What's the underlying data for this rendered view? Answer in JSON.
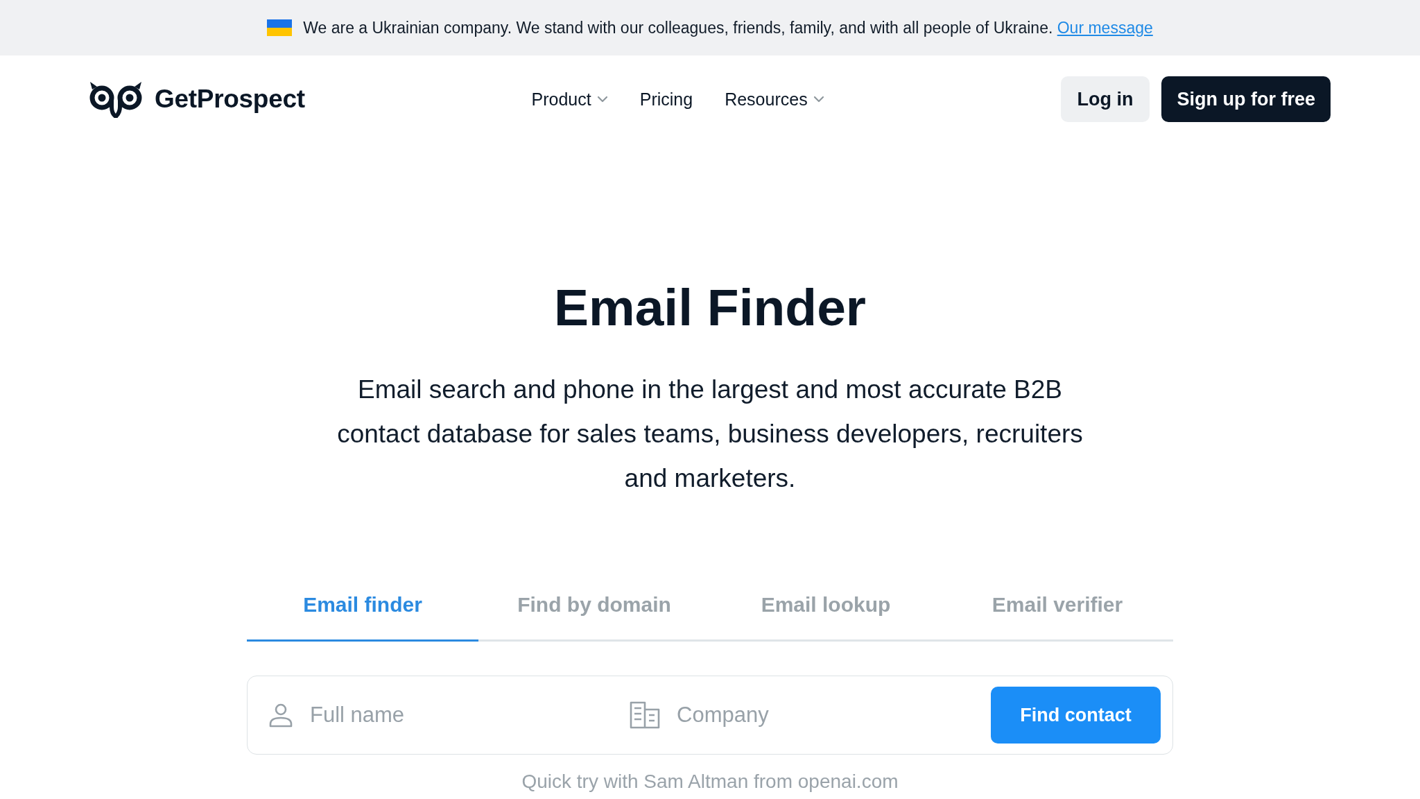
{
  "banner": {
    "message": "We are a Ukrainian company. We stand with our colleagues, friends, family, and with all people of Ukraine.",
    "link": "Our message"
  },
  "header": {
    "logo_text": "GetProspect",
    "nav": [
      {
        "label": "Product",
        "has_menu": true
      },
      {
        "label": "Pricing",
        "has_menu": false
      },
      {
        "label": "Resources",
        "has_menu": true
      }
    ],
    "buttons": [
      {
        "label": "Log in",
        "kind": "secondary"
      },
      {
        "label": "Sign up for free",
        "kind": "primary"
      }
    ]
  },
  "hero": {
    "title": "Email Finder",
    "subtitle": "Email search and phone in the largest and most accurate B2B contact database for sales teams, business developers, recruiters and marketers."
  },
  "tabs": [
    {
      "label": "Email finder",
      "selected": true
    },
    {
      "label": "Find by domain",
      "selected": false
    },
    {
      "label": "Email lookup",
      "selected": false
    },
    {
      "label": "Email verifier",
      "selected": false
    }
  ],
  "search_form": {
    "fields": [
      {
        "kind": "person",
        "placeholder": "Full name"
      },
      {
        "kind": "company",
        "placeholder": "Company"
      }
    ],
    "button": "Find contact"
  },
  "quick_try": "Quick try with Sam Altman from openai.com"
}
